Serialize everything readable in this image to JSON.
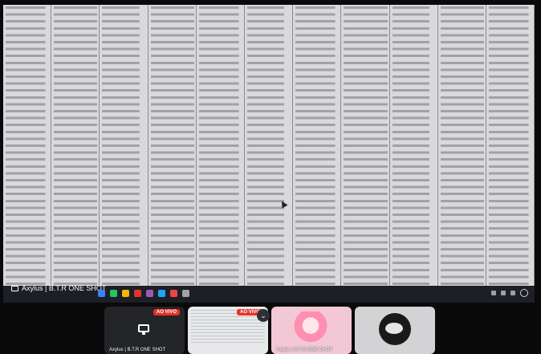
{
  "presentation": {
    "presenter_label": "Axylus | B.T.R ONE SHOT"
  },
  "taskbar": {
    "icons": [
      "network-icon",
      "chrome-icon",
      "folder-icon",
      "mail-icon",
      "store-icon",
      "edge-icon",
      "app-icon",
      "settings-icon"
    ],
    "icon_colors": [
      "#3b82f6",
      "#22c55e",
      "#f5b400",
      "#e5332a",
      "#9b59b6",
      "#1fa2ff",
      "#ef4444",
      "#a3a3a3"
    ]
  },
  "participants": [
    {
      "live": "AO VIVO",
      "name": "Axylus | B.T.R ONE SHOT"
    },
    {
      "live": "AO VIVO",
      "name": ""
    },
    {
      "live": "",
      "name": "Axylus | B.T.R ONE SHOT"
    },
    {
      "live": "",
      "name": ""
    }
  ],
  "colors": {
    "live_badge": "#e5332a",
    "taskbar": "#1d1f26",
    "background": "#0a0a0b"
  }
}
